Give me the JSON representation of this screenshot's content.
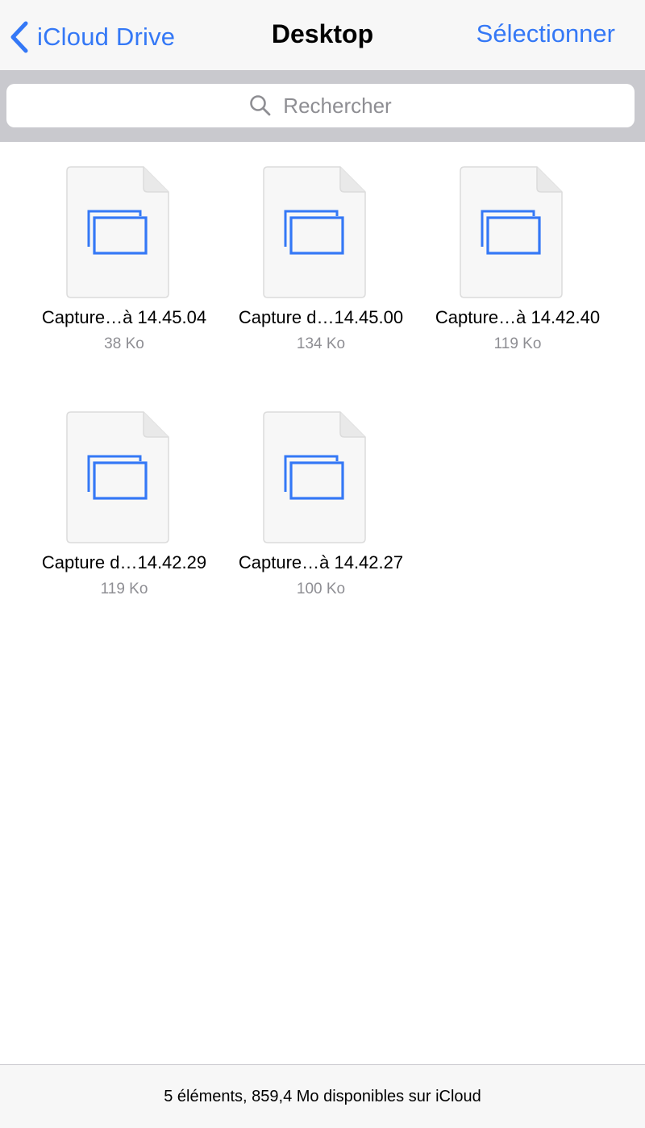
{
  "nav": {
    "back_label": "iCloud Drive",
    "title": "Desktop",
    "select_label": "Sélectionner"
  },
  "search": {
    "placeholder": "Rechercher"
  },
  "files": [
    {
      "name": "Capture…à 14.45.04",
      "size": "38 Ko"
    },
    {
      "name": "Capture d…14.45.00",
      "size": "134 Ko"
    },
    {
      "name": "Capture…à 14.42.40",
      "size": "119 Ko"
    },
    {
      "name": "Capture d…14.42.29",
      "size": "119 Ko"
    },
    {
      "name": "Capture…à 14.42.27",
      "size": "100 Ko"
    }
  ],
  "footer": {
    "status": "5 éléments, 859,4 Mo disponibles sur iCloud"
  },
  "colors": {
    "accent": "#3478f6",
    "secondary_text": "#8e8e93",
    "bar_background": "#f7f7f7",
    "search_background": "#c9c9ce",
    "document_fill": "#f7f7f7"
  },
  "icons": {
    "back": "chevron-left-icon",
    "search": "magnifier-icon",
    "file": "screenshot-document-icon"
  }
}
